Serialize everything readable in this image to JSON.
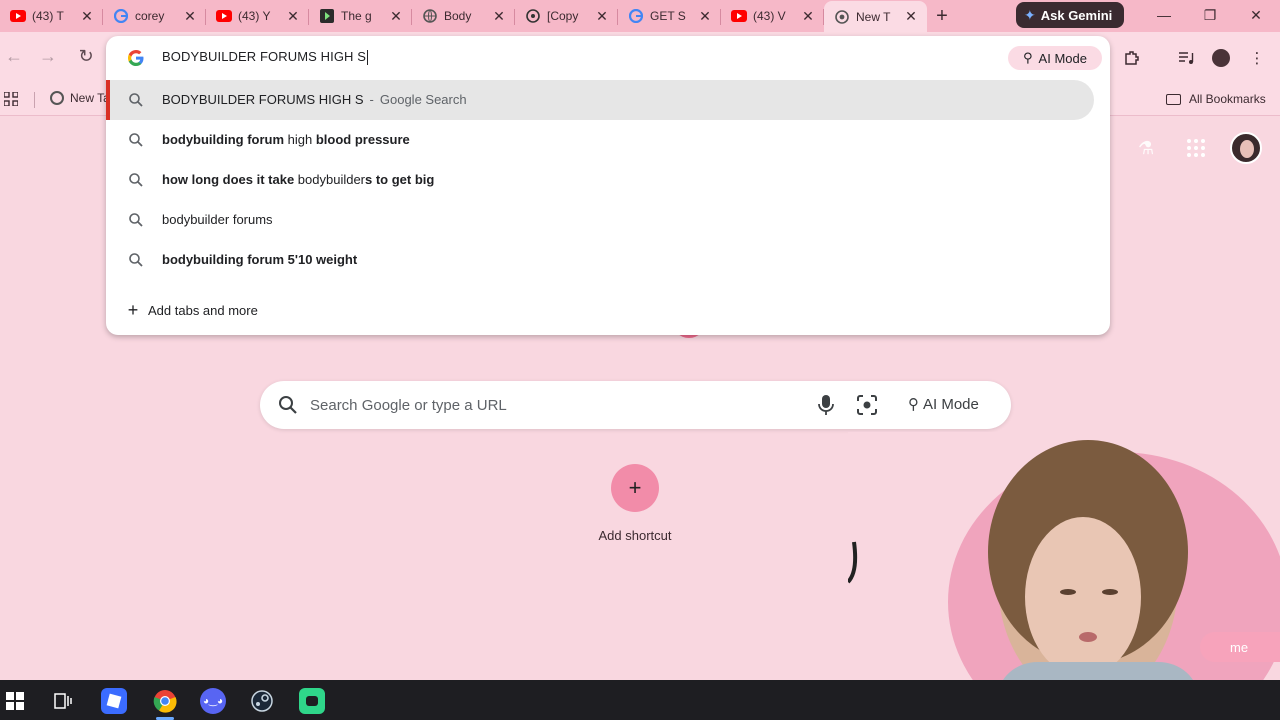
{
  "browser": {
    "tabs": [
      {
        "title": "(43) T",
        "favicon": "youtube-icon"
      },
      {
        "title": "corey",
        "favicon": "google-icon"
      },
      {
        "title": "(43) Y",
        "favicon": "youtube-icon"
      },
      {
        "title": "The g",
        "favicon": "play-icon"
      },
      {
        "title": "Body",
        "favicon": "globe-icon"
      },
      {
        "title": "[Copy",
        "favicon": "chatgpt-icon"
      },
      {
        "title": "GET S",
        "favicon": "google-icon"
      },
      {
        "title": "(43) V",
        "favicon": "youtube-icon"
      },
      {
        "title": "New T",
        "favicon": "chrome-icon",
        "active": true
      }
    ],
    "ask_gemini_label": "Ask Gemini",
    "bookmarks": {
      "new_tab_label": "New Ta",
      "all_bookmarks_label": "All Bookmarks"
    }
  },
  "omnibox": {
    "input_value": "BODYBUILDER FORUMS HIGH S",
    "ai_mode_label": "AI Mode",
    "suggestions": [
      {
        "parts": [
          [
            "BODYBUILDER FORUMS HIGH S",
            false
          ]
        ],
        "source": "Google Search",
        "selected": true
      },
      {
        "parts": [
          [
            "bodybuilding forum",
            true
          ],
          [
            " high ",
            false
          ],
          [
            "blood pressure",
            true
          ]
        ]
      },
      {
        "parts": [
          [
            "how long does it take",
            true
          ],
          [
            " bodybuilder",
            false
          ],
          [
            "s to get big",
            true
          ]
        ]
      },
      {
        "parts": [
          [
            "bodybuilder forums",
            false
          ]
        ]
      },
      {
        "parts": [
          [
            "bodybuilding forum 5'10 weight",
            true
          ]
        ]
      }
    ],
    "add_tabs_label": "Add tabs and more"
  },
  "ntp": {
    "search_placeholder": "Search Google or type a URL",
    "ai_mode_label": "AI Mode",
    "add_shortcut_label": "Add shortcut",
    "customize_partial_label": "me"
  },
  "colors": {
    "tab_strip": "#f6b8c8",
    "toolbar": "#fbdbe4",
    "page_bg": "#f9d7e0",
    "youtube_red": "#ff0000",
    "selection_accent": "#d93025"
  }
}
